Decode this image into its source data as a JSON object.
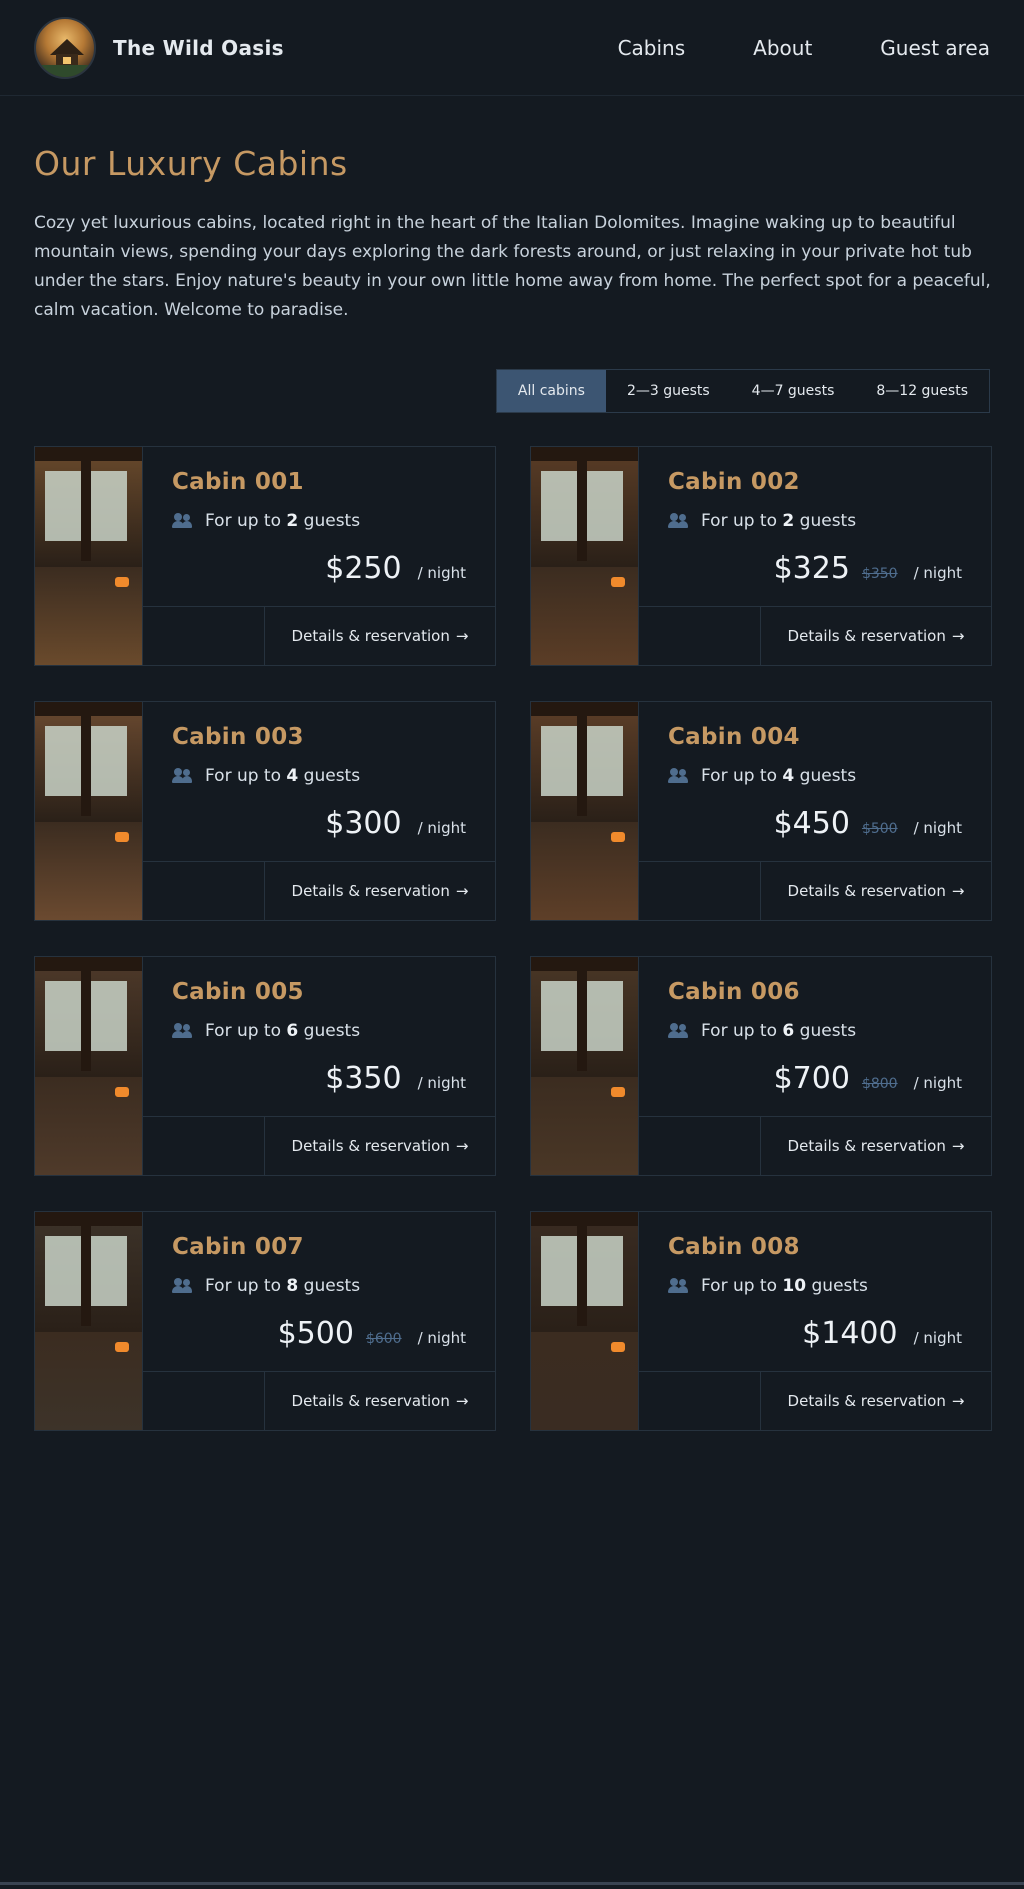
{
  "header": {
    "brand_name": "The Wild Oasis",
    "nav": [
      {
        "label": "Cabins"
      },
      {
        "label": "About"
      },
      {
        "label": "Guest area"
      }
    ]
  },
  "main": {
    "title": "Our Luxury Cabins",
    "intro": "Cozy yet luxurious cabins, located right in the heart of the Italian Dolomites. Imagine waking up to beautiful mountain views, spending your days exploring the dark forests around, or just relaxing in your private hot tub under the stars. Enjoy nature's beauty in your own little home away from home. The perfect spot for a peaceful, calm vacation. Welcome to paradise.",
    "filters": [
      {
        "label": "All cabins",
        "active": true
      },
      {
        "label": "2—3 guests",
        "active": false
      },
      {
        "label": "4—7 guests",
        "active": false
      },
      {
        "label": "8—12 guests",
        "active": false
      }
    ]
  },
  "cabin_labels": {
    "guests_prefix": "For up to",
    "guests_suffix": "guests",
    "per_night": "/ night",
    "details": "Details & reservation",
    "arrow": "→"
  },
  "cabins": [
    {
      "name": "Cabin 001",
      "guests": "2",
      "price": "$250",
      "old_price": "",
      "photo_tone": "#6a4a2c"
    },
    {
      "name": "Cabin 002",
      "guests": "2",
      "price": "$325",
      "old_price": "$350",
      "photo_tone": "#5b3d26"
    },
    {
      "name": "Cabin 003",
      "guests": "4",
      "price": "$300",
      "old_price": "",
      "photo_tone": "#6b4a30"
    },
    {
      "name": "Cabin 004",
      "guests": "4",
      "price": "$450",
      "old_price": "$500",
      "photo_tone": "#5e3f28"
    },
    {
      "name": "Cabin 005",
      "guests": "6",
      "price": "$350",
      "old_price": "",
      "photo_tone": "#4f3a2a"
    },
    {
      "name": "Cabin 006",
      "guests": "6",
      "price": "$700",
      "old_price": "$800",
      "photo_tone": "#4a3726"
    },
    {
      "name": "Cabin 007",
      "guests": "8",
      "price": "$500",
      "old_price": "$600",
      "photo_tone": "#3d3329"
    },
    {
      "name": "Cabin 008",
      "guests": "10",
      "price": "$1400",
      "old_price": "",
      "photo_tone": "#3a2c22"
    }
  ]
}
